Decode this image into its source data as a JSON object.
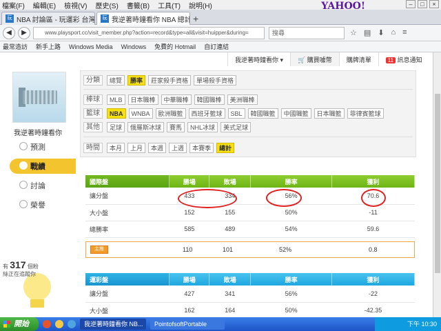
{
  "menubar": {
    "items": [
      "檔案(F)",
      "編輯(E)",
      "檢視(V)",
      "歷史(S)",
      "書籤(B)",
      "工具(T)",
      "說明(H)"
    ],
    "brand": "YAHOO!"
  },
  "tabs": [
    {
      "label": "NBA 討論區 - 玩運彩 台灣…",
      "active": false
    },
    {
      "label": "我逆著時鐘看你 NBA 總計…",
      "active": true
    }
  ],
  "address": {
    "url": "www.playsport.cc/visit_member.php?action=record&type=all&visit=huipper&during=",
    "search_placeholder": "搜尋"
  },
  "bookmarks": [
    "最常造訪",
    "新手上路",
    "Windows Media",
    "Windows",
    "免費的 Hotmail",
    "自訂連結"
  ],
  "memberbar": {
    "link1": "我逆著時鐘看你 ▾",
    "cart": "購買噱幣",
    "history": "購牌清單",
    "notify_count": "11",
    "notify": "訊息通知"
  },
  "sidebar": {
    "username": "我逆著時鐘看你",
    "items": [
      "預測",
      "戰績",
      "討論",
      "榮譽"
    ],
    "active_index": 1,
    "fans_prefix": "有",
    "fans_count": "317",
    "fans_unit": "個粉",
    "fans_suffix": "絲正在追蹤你"
  },
  "filters": {
    "cat_label": "分類",
    "cat_options": [
      "總覽",
      "勝率",
      "莊家殺手資格",
      "單場殺手資格"
    ],
    "cat_selected": "勝率",
    "baseball_label": "棒球",
    "baseball_options": [
      "MLB",
      "日本職棒",
      "中華職棒",
      "韓國職棒",
      "美洲職棒"
    ],
    "basketball_label": "籃球",
    "basketball_options": [
      "NBA",
      "WNBA",
      "歐洲職籃",
      "西班牙籃球",
      "SBL",
      "韓國職籃",
      "中國職籃",
      "日本職籃",
      "菲律賓籃球"
    ],
    "basketball_selected": "NBA",
    "other_label": "其他",
    "other_options": [
      "足球",
      "俄羅斯冰球",
      "賽馬",
      "NHL冰球",
      "美式足球"
    ],
    "time_label": "時間",
    "time_options": [
      "本月",
      "上月",
      "本週",
      "上週",
      "本賽季",
      "總計"
    ],
    "time_selected": "總計"
  },
  "intl_table": {
    "headers": [
      "國際盤",
      "勝場",
      "敗場",
      "勝率",
      "獲利"
    ],
    "rows": [
      [
        "讓分盤",
        "433",
        "334",
        "56%",
        "70.6"
      ],
      [
        "大小盤",
        "152",
        "155",
        "50%",
        "-11"
      ],
      [
        "總勝率",
        "585",
        "489",
        "54%",
        "59.6"
      ]
    ],
    "summary": {
      "tag": "主推",
      "win": "110",
      "lose": "101",
      "rate": "52%",
      "profit": "0.8"
    }
  },
  "lottery_table": {
    "headers": [
      "運彩盤",
      "勝場",
      "敗場",
      "勝率",
      "獲利"
    ],
    "rows": [
      [
        "讓分盤",
        "427",
        "341",
        "56%",
        "-22"
      ],
      [
        "大小盤",
        "162",
        "164",
        "50%",
        "-42.35"
      ]
    ]
  },
  "taskbar": {
    "start": "開始",
    "task1": "我逆著時鐘看你 NB...",
    "task2": "PointofsoftPortable",
    "time": "下午 10:30"
  },
  "colors": {
    "green_header": "#7cc222",
    "blue_header": "#2db2e7",
    "selected_option": "#f7e00f",
    "active_menu": "#f3c42e",
    "annotation": "#e02020"
  }
}
